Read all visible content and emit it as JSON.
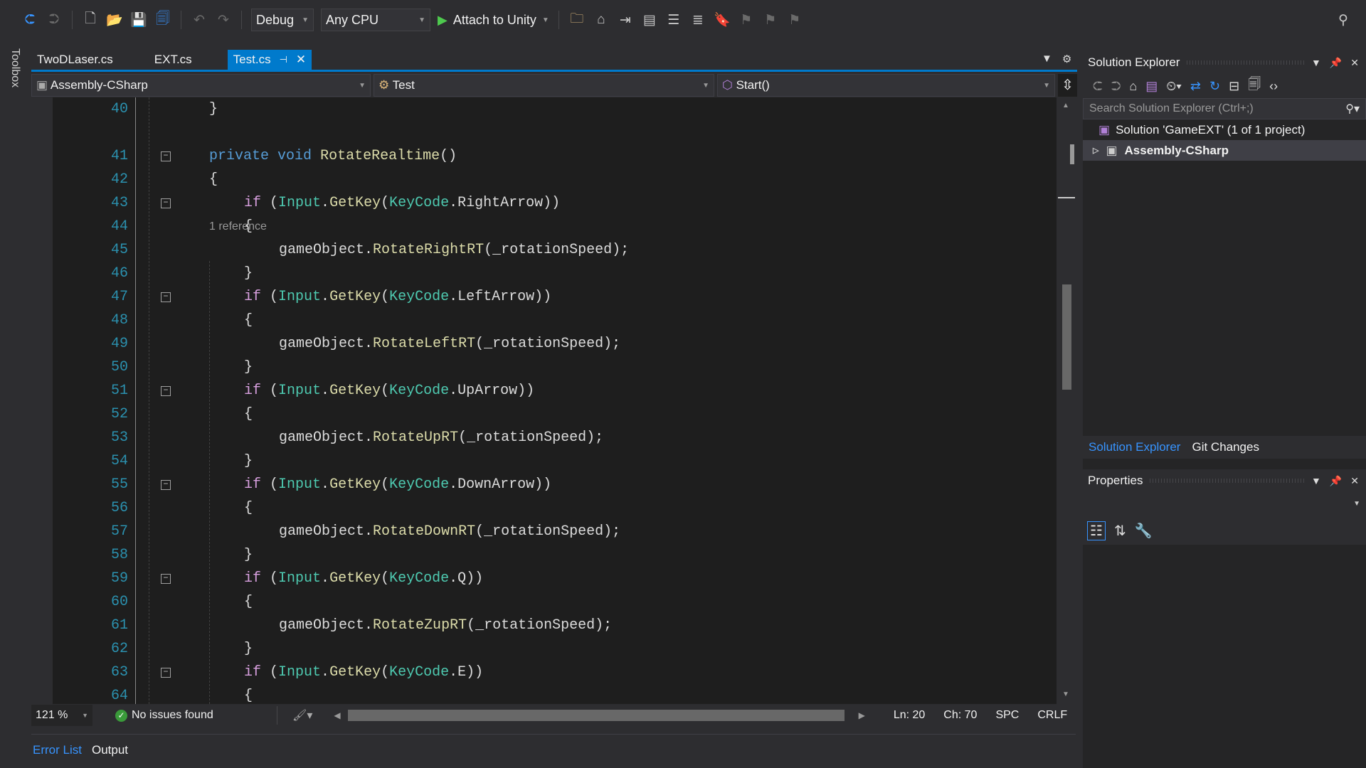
{
  "toolbar": {
    "config": "Debug",
    "platform": "Any CPU",
    "run_label": "Attach to Unity",
    "icons": [
      "back-icon",
      "forward-icon",
      "new-project-icon",
      "open-icon",
      "save-icon",
      "save-all-icon",
      "undo-icon",
      "redo-icon"
    ]
  },
  "toolbox": {
    "label": "Toolbox"
  },
  "tabs": [
    {
      "label": "TwoDLaser.cs"
    },
    {
      "label": "EXT.cs"
    },
    {
      "label": "Test.cs",
      "active": true
    }
  ],
  "nav": {
    "project": "Assembly-CSharp",
    "class": "Test",
    "member": "Start()"
  },
  "editor": {
    "codelens": "1 reference",
    "lines": [
      {
        "n": "40",
        "i": 1,
        "t": [
          [
            "}",
            "p"
          ]
        ]
      },
      {
        "n": "41",
        "i": 1,
        "f": 1,
        "t": [
          [
            "private",
            "k"
          ],
          [
            " ",
            "p"
          ],
          [
            "void",
            "k"
          ],
          [
            " ",
            "p"
          ],
          [
            "RotateRealtime",
            "m"
          ],
          [
            "()",
            "p"
          ]
        ]
      },
      {
        "n": "42",
        "i": 1,
        "t": [
          [
            "{",
            "p"
          ]
        ]
      },
      {
        "n": "43",
        "i": 2,
        "f": 1,
        "t": [
          [
            "if",
            "c"
          ],
          [
            " (",
            "p"
          ],
          [
            "Input",
            "y"
          ],
          [
            ".",
            "p"
          ],
          [
            "GetKey",
            "m"
          ],
          [
            "(",
            "p"
          ],
          [
            "KeyCode",
            "y"
          ],
          [
            ".",
            "p"
          ],
          [
            "RightArrow",
            "p"
          ],
          [
            "))",
            "p"
          ]
        ]
      },
      {
        "n": "44",
        "i": 2,
        "t": [
          [
            "{",
            "p"
          ]
        ]
      },
      {
        "n": "45",
        "i": 3,
        "t": [
          [
            "gameObject",
            "p"
          ],
          [
            ".",
            "p"
          ],
          [
            "RotateRightRT",
            "m"
          ],
          [
            "(_rotationSpeed);",
            "p"
          ]
        ]
      },
      {
        "n": "46",
        "i": 2,
        "t": [
          [
            "}",
            "p"
          ]
        ]
      },
      {
        "n": "47",
        "i": 2,
        "f": 1,
        "t": [
          [
            "if",
            "c"
          ],
          [
            " (",
            "p"
          ],
          [
            "Input",
            "y"
          ],
          [
            ".",
            "p"
          ],
          [
            "GetKey",
            "m"
          ],
          [
            "(",
            "p"
          ],
          [
            "KeyCode",
            "y"
          ],
          [
            ".",
            "p"
          ],
          [
            "LeftArrow",
            "p"
          ],
          [
            "))",
            "p"
          ]
        ]
      },
      {
        "n": "48",
        "i": 2,
        "t": [
          [
            "{",
            "p"
          ]
        ]
      },
      {
        "n": "49",
        "i": 3,
        "t": [
          [
            "gameObject",
            "p"
          ],
          [
            ".",
            "p"
          ],
          [
            "RotateLeftRT",
            "m"
          ],
          [
            "(_rotationSpeed);",
            "p"
          ]
        ]
      },
      {
        "n": "50",
        "i": 2,
        "t": [
          [
            "}",
            "p"
          ]
        ]
      },
      {
        "n": "51",
        "i": 2,
        "f": 1,
        "t": [
          [
            "if",
            "c"
          ],
          [
            " (",
            "p"
          ],
          [
            "Input",
            "y"
          ],
          [
            ".",
            "p"
          ],
          [
            "GetKey",
            "m"
          ],
          [
            "(",
            "p"
          ],
          [
            "KeyCode",
            "y"
          ],
          [
            ".",
            "p"
          ],
          [
            "UpArrow",
            "p"
          ],
          [
            "))",
            "p"
          ]
        ]
      },
      {
        "n": "52",
        "i": 2,
        "t": [
          [
            "{",
            "p"
          ]
        ]
      },
      {
        "n": "53",
        "i": 3,
        "t": [
          [
            "gameObject",
            "p"
          ],
          [
            ".",
            "p"
          ],
          [
            "RotateUpRT",
            "m"
          ],
          [
            "(_rotationSpeed);",
            "p"
          ]
        ]
      },
      {
        "n": "54",
        "i": 2,
        "t": [
          [
            "}",
            "p"
          ]
        ]
      },
      {
        "n": "55",
        "i": 2,
        "f": 1,
        "t": [
          [
            "if",
            "c"
          ],
          [
            " (",
            "p"
          ],
          [
            "Input",
            "y"
          ],
          [
            ".",
            "p"
          ],
          [
            "GetKey",
            "m"
          ],
          [
            "(",
            "p"
          ],
          [
            "KeyCode",
            "y"
          ],
          [
            ".",
            "p"
          ],
          [
            "DownArrow",
            "p"
          ],
          [
            "))",
            "p"
          ]
        ]
      },
      {
        "n": "56",
        "i": 2,
        "t": [
          [
            "{",
            "p"
          ]
        ]
      },
      {
        "n": "57",
        "i": 3,
        "t": [
          [
            "gameObject",
            "p"
          ],
          [
            ".",
            "p"
          ],
          [
            "RotateDownRT",
            "m"
          ],
          [
            "(_rotationSpeed);",
            "p"
          ]
        ]
      },
      {
        "n": "58",
        "i": 2,
        "t": [
          [
            "}",
            "p"
          ]
        ]
      },
      {
        "n": "59",
        "i": 2,
        "f": 1,
        "t": [
          [
            "if",
            "c"
          ],
          [
            " (",
            "p"
          ],
          [
            "Input",
            "y"
          ],
          [
            ".",
            "p"
          ],
          [
            "GetKey",
            "m"
          ],
          [
            "(",
            "p"
          ],
          [
            "KeyCode",
            "y"
          ],
          [
            ".",
            "p"
          ],
          [
            "Q",
            "p"
          ],
          [
            "))",
            "p"
          ]
        ]
      },
      {
        "n": "60",
        "i": 2,
        "t": [
          [
            "{",
            "p"
          ]
        ]
      },
      {
        "n": "61",
        "i": 3,
        "t": [
          [
            "gameObject",
            "p"
          ],
          [
            ".",
            "p"
          ],
          [
            "RotateZupRT",
            "m"
          ],
          [
            "(_rotationSpeed);",
            "p"
          ]
        ]
      },
      {
        "n": "62",
        "i": 2,
        "t": [
          [
            "}",
            "p"
          ]
        ]
      },
      {
        "n": "63",
        "i": 2,
        "f": 1,
        "t": [
          [
            "if",
            "c"
          ],
          [
            " (",
            "p"
          ],
          [
            "Input",
            "y"
          ],
          [
            ".",
            "p"
          ],
          [
            "GetKey",
            "m"
          ],
          [
            "(",
            "p"
          ],
          [
            "KeyCode",
            "y"
          ],
          [
            ".",
            "p"
          ],
          [
            "E",
            "p"
          ],
          [
            "))",
            "p"
          ]
        ]
      },
      {
        "n": "64",
        "i": 2,
        "t": [
          [
            "{",
            "p"
          ]
        ]
      }
    ],
    "colors": {
      "k": "#569cd6",
      "c": "#d8a0df",
      "y": "#4ec9b0",
      "m": "#dcdcaa",
      "p": "#dcdcdc"
    }
  },
  "status": {
    "zoom": "121 %",
    "issues": "No issues found",
    "ln": "Ln: 20",
    "ch": "Ch: 70",
    "spc": "SPC",
    "crlf": "CRLF"
  },
  "bottom_tabs": [
    {
      "label": "Error List",
      "active": true
    },
    {
      "label": "Output"
    }
  ],
  "solution_explorer": {
    "title": "Solution Explorer",
    "search_placeholder": "Search Solution Explorer (Ctrl+;)",
    "solution": "Solution 'GameEXT' (1 of 1 project)",
    "project": "Assembly-CSharp"
  },
  "right_tabs": [
    {
      "label": "Solution Explorer",
      "active": true
    },
    {
      "label": "Git Changes"
    }
  ],
  "properties": {
    "title": "Properties"
  }
}
